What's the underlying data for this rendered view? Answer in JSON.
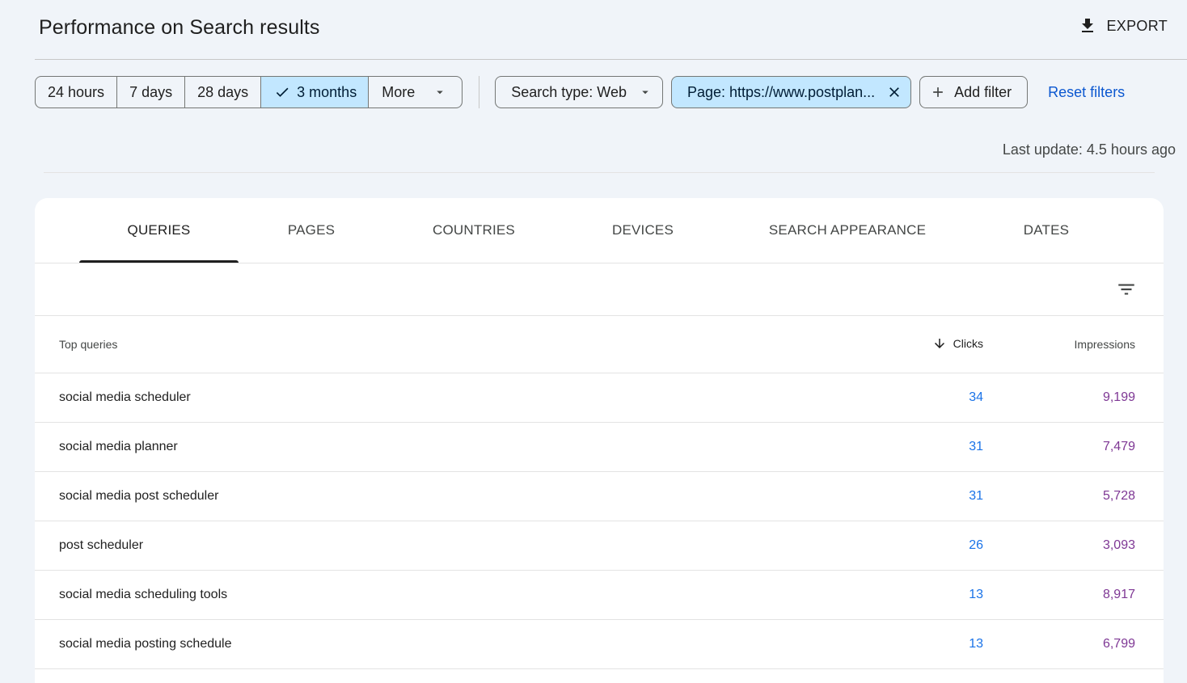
{
  "header": {
    "title": "Performance on Search results",
    "export_label": "EXPORT"
  },
  "date_range": {
    "options": [
      {
        "label": "24 hours",
        "selected": false
      },
      {
        "label": "7 days",
        "selected": false
      },
      {
        "label": "28 days",
        "selected": false
      },
      {
        "label": "3 months",
        "selected": true
      }
    ],
    "more_label": "More"
  },
  "filters": {
    "search_type": "Search type: Web",
    "page_filter": "Page: https://www.postplan...",
    "add_filter": "Add filter",
    "reset": "Reset filters"
  },
  "last_update": "Last update: 4.5 hours ago",
  "tabs": [
    {
      "label": "QUERIES",
      "active": true
    },
    {
      "label": "PAGES",
      "active": false
    },
    {
      "label": "COUNTRIES",
      "active": false
    },
    {
      "label": "DEVICES",
      "active": false
    },
    {
      "label": "SEARCH APPEARANCE",
      "active": false
    },
    {
      "label": "DATES",
      "active": false
    }
  ],
  "table": {
    "headers": {
      "query": "Top queries",
      "clicks": "Clicks",
      "impressions": "Impressions"
    },
    "sorted_by": "Clicks",
    "rows": [
      {
        "query": "social media scheduler",
        "clicks": "34",
        "impressions": "9,199"
      },
      {
        "query": "social media planner",
        "clicks": "31",
        "impressions": "7,479"
      },
      {
        "query": "social media post scheduler",
        "clicks": "31",
        "impressions": "5,728"
      },
      {
        "query": "post scheduler",
        "clicks": "26",
        "impressions": "3,093"
      },
      {
        "query": "social media scheduling tools",
        "clicks": "13",
        "impressions": "8,917"
      },
      {
        "query": "social media posting schedule",
        "clicks": "13",
        "impressions": "6,799"
      }
    ]
  },
  "colors": {
    "accent_blue": "#0b57d0",
    "selected_bg": "#c2e7ff",
    "clicks_color": "#1a73e8",
    "impressions_color": "#7e3794"
  }
}
